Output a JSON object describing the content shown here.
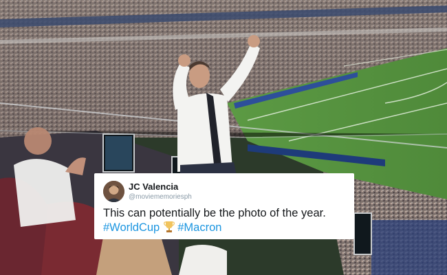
{
  "tweet": {
    "display_name": "JC Valencia",
    "handle": "@moviememoriesph",
    "text": "This can potentially be the photo of the year.",
    "hashtag_1": "#WorldCup",
    "hashtag_2": "#Macron",
    "emoji": "trophy-icon"
  },
  "colors": {
    "hashtag": "#1b95e0",
    "pitch": "#4f8a3a",
    "shirt": "#f3f3f1"
  }
}
